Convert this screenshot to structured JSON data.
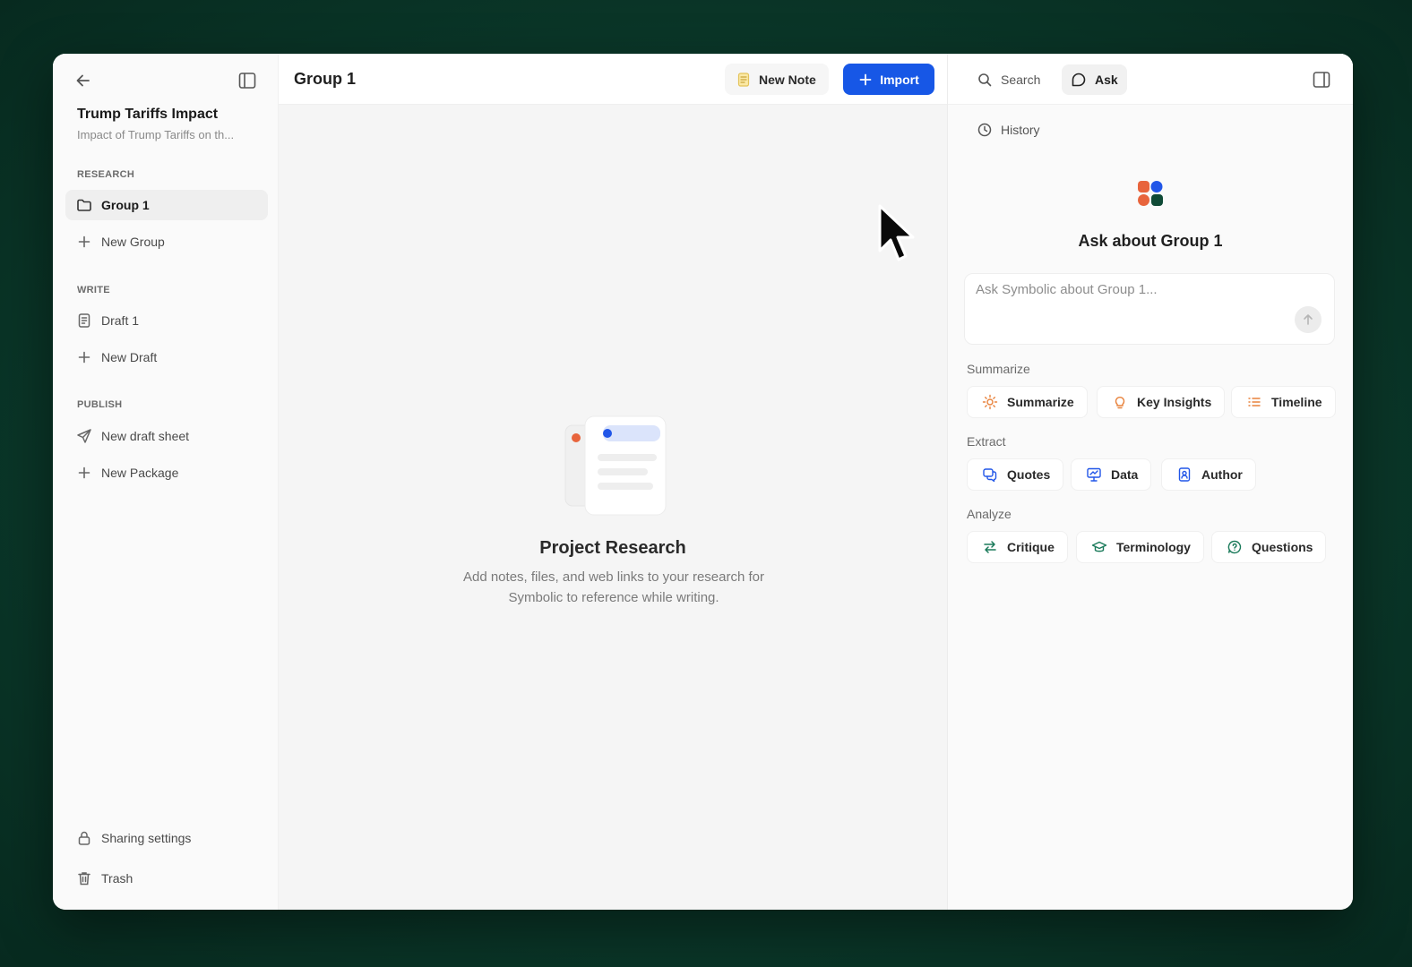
{
  "sidebar": {
    "project_title": "Trump Tariffs Impact",
    "project_subtitle": "Impact of Trump Tariffs on th...",
    "sections": {
      "research": "RESEARCH",
      "write": "WRITE",
      "publish": "PUBLISH"
    },
    "research_items": [
      "Group 1",
      "New Group"
    ],
    "write_items": [
      "Draft 1",
      "New Draft"
    ],
    "publish_items": [
      "New draft sheet",
      "New Package"
    ],
    "footer_items": [
      "Sharing settings",
      "Trash"
    ]
  },
  "main": {
    "title": "Group 1",
    "new_note_label": "New Note",
    "import_label": "Import",
    "empty_title": "Project Research",
    "empty_description": "Add notes, files, and web links to your research for Symbolic to reference while writing."
  },
  "right_panel": {
    "tabs": [
      "Search",
      "Ask"
    ],
    "history_label": "History",
    "ask_title": "Ask about Group 1",
    "ask_placeholder": "Ask Symbolic about Group 1...",
    "groups": {
      "summarize": {
        "label": "Summarize",
        "chips": [
          "Summarize",
          "Key Insights",
          "Timeline"
        ]
      },
      "extract": {
        "label": "Extract",
        "chips": [
          "Quotes",
          "Data",
          "Author"
        ]
      },
      "analyze": {
        "label": "Analyze",
        "chips": [
          "Critique",
          "Terminology",
          "Questions"
        ]
      }
    }
  },
  "colors": {
    "accent": "#1757e6",
    "background": "#0b3a2b",
    "logo_orange": "#e8643c",
    "logo_blue": "#2156e8",
    "logo_green": "#0f4a36"
  }
}
